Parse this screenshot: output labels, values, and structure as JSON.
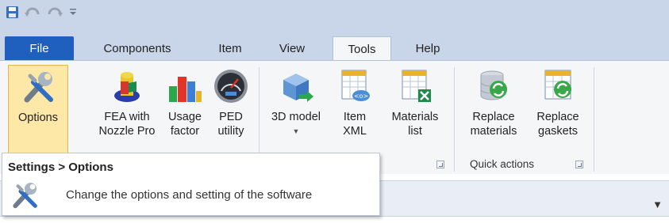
{
  "quick_access": {
    "icons": [
      "save-icon",
      "undo-icon",
      "redo-icon",
      "customize-qat-icon"
    ]
  },
  "tabs": {
    "file": "File",
    "components": "Components",
    "item": "Item",
    "view": "View",
    "tools": "Tools",
    "help": "Help"
  },
  "ribbon": {
    "options": {
      "label": "Options",
      "icon": "wrench-screwdriver-icon"
    },
    "fea": {
      "line1": "FEA with",
      "line2": "Nozzle Pro",
      "icon": "fea-nozzle-icon"
    },
    "usage": {
      "line1": "Usage",
      "line2": "factor",
      "icon": "bar-chart-icon"
    },
    "ped": {
      "line1": "PED",
      "line2": "utility",
      "icon": "gauge-icon"
    },
    "model3d": {
      "label": "3D model",
      "icon": "cube-export-icon"
    },
    "itemxml": {
      "line1": "Item",
      "line2": "XML",
      "icon": "xml-table-icon"
    },
    "matlist": {
      "line1": "Materials",
      "line2": "list",
      "icon": "excel-table-icon"
    },
    "replace_mat": {
      "line1": "Replace",
      "line2": "materials",
      "icon": "database-refresh-icon"
    },
    "replace_gask": {
      "line1": "Replace",
      "line2": "gaskets",
      "icon": "table-refresh-icon"
    },
    "groups": {
      "quick_actions": "Quick actions"
    }
  },
  "tooltip": {
    "title": "Settings > Options",
    "description": "Change the options and setting of the software",
    "icon": "wrench-screwdriver-icon"
  },
  "colors": {
    "ribbon_bg": "#c9d6ea",
    "file_tab": "#1f5fbd",
    "hover": "#fde8a8"
  }
}
